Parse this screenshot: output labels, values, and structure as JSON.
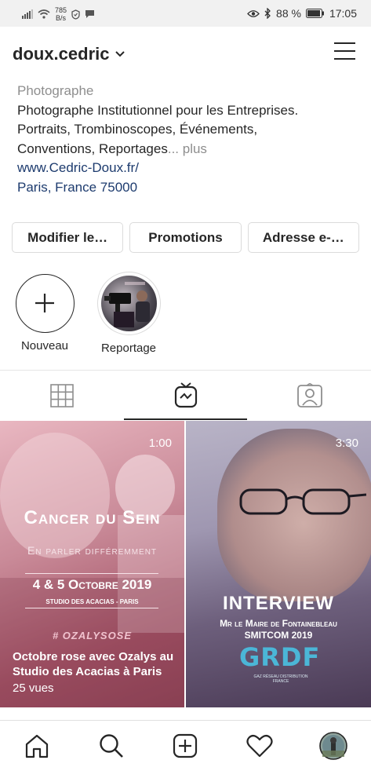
{
  "status_bar": {
    "netspeed_value": "785",
    "netspeed_unit": "B/s",
    "battery": "88 %",
    "time": "17:05"
  },
  "header": {
    "username": "doux.cedric"
  },
  "bio": {
    "category": "Photographe",
    "line1": "Photographe Institutionnel pour les Entreprises.",
    "line2": "Portraits, Trombinoscopes, Événements,",
    "line3": "Conventions, Reportages",
    "more": "... plus",
    "website": "www.Cedric-Doux.fr/",
    "location": "Paris, France 75000"
  },
  "buttons": {
    "edit": "Modifier le…",
    "promotions": "Promotions",
    "email": "Adresse e-…"
  },
  "highlights": [
    {
      "label": "Nouveau"
    },
    {
      "label": "Reportage"
    }
  ],
  "videos": [
    {
      "duration": "1:00",
      "title": "Cancer du Sein",
      "subtitle": "En parler différemment",
      "date": "4 & 5 Octobre 2019",
      "venue": "STUDIO DES ACACIAS - PARIS",
      "hashtag": "# OZALYSOSE",
      "caption": "Octobre rose avec Ozalys au Studio des Acacias à Paris",
      "views": "25 vues"
    },
    {
      "duration": "3:30",
      "title": "INTERVIEW",
      "subtitle1": "Mr le Maire de Fontainebleau",
      "subtitle2": "SMITCOM 2019",
      "logo": "GRDF",
      "logo_sub": "GAZ RÉSEAU DISTRIBUTION FRANCE"
    }
  ]
}
